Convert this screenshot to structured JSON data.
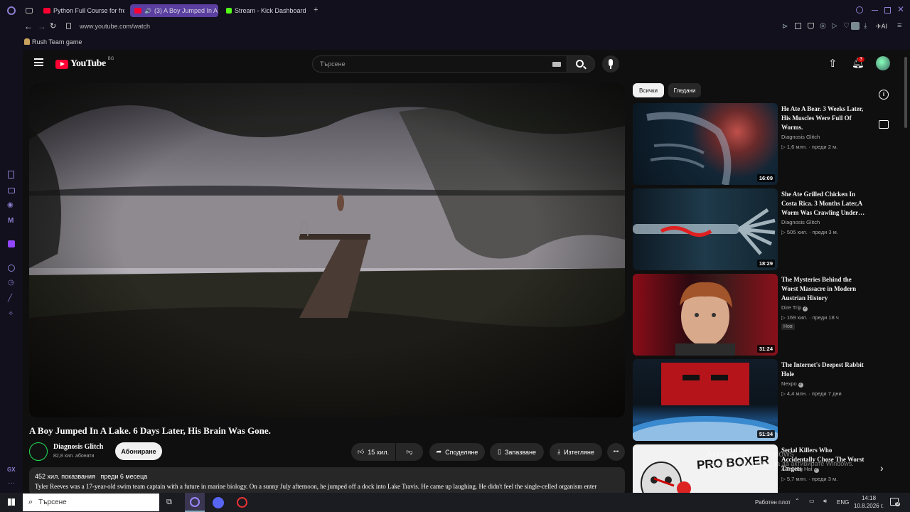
{
  "browser": {
    "tabs": [
      {
        "label": "Python Full Course for free",
        "active": false
      },
      {
        "label": "(3) A Boy Jumped In A",
        "active": true
      },
      {
        "label": "Stream - Kick Dashboard",
        "active": false
      }
    ],
    "new_tab": "+",
    "url": "www.youtube.com/watch",
    "bookmark": "Rush Team game",
    "ai_label": "AI"
  },
  "youtube": {
    "logo": "YouTube",
    "region": "BG",
    "search_placeholder": "Търсене",
    "notification_count": "3",
    "chips": [
      "Всички",
      "Гледани"
    ],
    "video": {
      "title": "A Boy Jumped In A Lake. 6 Days Later, His Brain Was Gone.",
      "channel": "Diagnosis Glitch",
      "subscribers": "82,8 хил. абонати",
      "subscribe": "Абониране",
      "likes": "15 хил.",
      "share": "Споделяне",
      "save": "Запазване",
      "download": "Изтегляне",
      "more": "•••",
      "views": "452 хил. показвания",
      "age": "преди 6 месеца",
      "description": "Tyler Reeves was a 17-year-old swim team captain with a future in marine biology. On a sunny July afternoon, he jumped off a dock into Lake Travis. He came up laughing. He didn't feel the single-celled organism enter"
    },
    "recommendations": [
      {
        "title": "He Ate A Bear. 3 Weeks Later, His Muscles Were Full Of Worms.",
        "channel": "Diagnosis Glitch",
        "verified": false,
        "views": "1,6 млн.",
        "age": "преди 2 м.",
        "duration": "16:09",
        "badge": ""
      },
      {
        "title": "She Ate Grilled Chicken In Costa Rica. 3 Months Later,A Worm Was Crawling Under…",
        "channel": "Diagnosis Glitch",
        "verified": false,
        "views": "505 хил.",
        "age": "преди 3 м.",
        "duration": "18:29",
        "badge": ""
      },
      {
        "title": "The Mysteries Behind the Worst Massacre in Modern Austrian History",
        "channel": "Dire Trip",
        "verified": true,
        "views": "169 хил.",
        "age": "преди 18 ч",
        "duration": "31:24",
        "badge": "Нов"
      },
      {
        "title": "The Internet's Deepest Rabbit Hole",
        "channel": "Nexpo",
        "verified": true,
        "views": "4,4 млн.",
        "age": "преди 7 дни",
        "duration": "51:34",
        "badge": ""
      },
      {
        "title": "Serial Killers Who Accidentally Chose The Worst Targets",
        "channel": "A Talking Hat",
        "verified": true,
        "views": "5,7 млн.",
        "age": "преди 3 м.",
        "duration": "",
        "badge": "",
        "thumb_text": "PRO BOXER"
      }
    ],
    "watermark": [
      "Активирайте Windows",
      "Отидете в Настройки, за да активирате Windows."
    ]
  },
  "taskbar": {
    "search_placeholder": "Търсене",
    "desktop_label": "Работен плот",
    "language": "ENG",
    "time": "14:18",
    "date": "10.8.2026 г.",
    "notifications": "9"
  },
  "colors": {
    "accent_tab": "#5b3fa0",
    "youtube_red": "#ff0033",
    "kick_green": "#53fc18"
  }
}
